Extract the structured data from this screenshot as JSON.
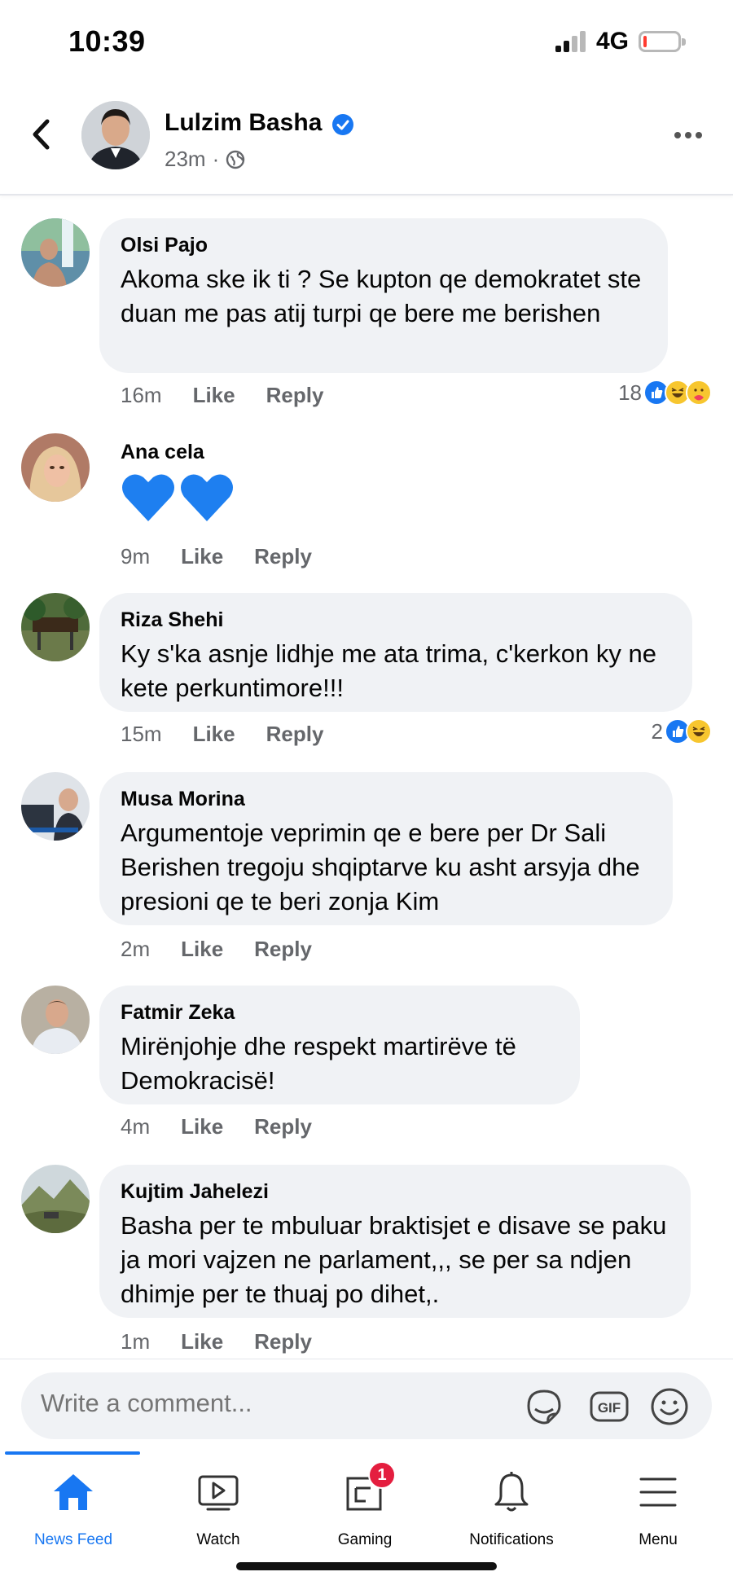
{
  "status_bar": {
    "time": "10:39",
    "network": "4G",
    "battery_level_pct": 10,
    "battery_color": "#ff3b30"
  },
  "post_header": {
    "author": "Lulzim Basha",
    "verified": true,
    "time_ago": "23m",
    "audience_icon": "globe-icon"
  },
  "comments": [
    {
      "author": "Olsi Pajo",
      "text": "Akoma ske ik ti ? Se kupton qe demokratet ste duan me pas atij turpi qe bere me berishen",
      "time": "16m",
      "like": "Like",
      "reply": "Reply",
      "reaction_count": "18",
      "reactions": [
        "like",
        "haha",
        "care"
      ]
    },
    {
      "author": "Ana cela",
      "text": "💙💙",
      "time": "9m",
      "like": "Like",
      "reply": "Reply"
    },
    {
      "author": "Riza Shehi",
      "text": "Ky s'ka asnje lidhje me ata trima, c'kerkon ky ne kete perkuntimore!!!",
      "time": "15m",
      "like": "Like",
      "reply": "Reply",
      "reaction_count": "2",
      "reactions": [
        "like",
        "haha"
      ]
    },
    {
      "author": "Musa Morina",
      "text": "Argumentoje veprimin qe e bere per Dr Sali Berishen tregoju shqiptarve ku asht arsyja dhe presioni qe te beri zonja Kim",
      "time": "2m",
      "like": "Like",
      "reply": "Reply"
    },
    {
      "author": "Fatmir Zeka",
      "text": "Mirënjohje dhe respekt martirëve të Demokracisë!",
      "time": "4m",
      "like": "Like",
      "reply": "Reply"
    },
    {
      "author": "Kujtim Jahelezi",
      "text": "Basha per te mbuluar braktisjet e disave se paku ja mori vajzen ne parlament,,, se per sa ndjen dhimje per te thuaj po dihet,.",
      "time": "1m",
      "like": "Like",
      "reply": "Reply"
    }
  ],
  "composer": {
    "placeholder": "Write a comment...",
    "icons": [
      "sticker-icon",
      "gif-icon",
      "emoji-icon"
    ]
  },
  "tab_bar": {
    "tabs": [
      {
        "label": "News Feed",
        "icon": "home-icon",
        "active": true
      },
      {
        "label": "Watch",
        "icon": "watch-icon"
      },
      {
        "label": "Gaming",
        "icon": "gaming-icon",
        "badge": "1"
      },
      {
        "label": "Notifications",
        "icon": "bell-icon"
      },
      {
        "label": "Menu",
        "icon": "menu-icon"
      }
    ]
  },
  "colors": {
    "accent": "#1877f2",
    "bubble": "#f0f2f5",
    "secondary_text": "#65676b",
    "badge": "#e41e3f"
  }
}
